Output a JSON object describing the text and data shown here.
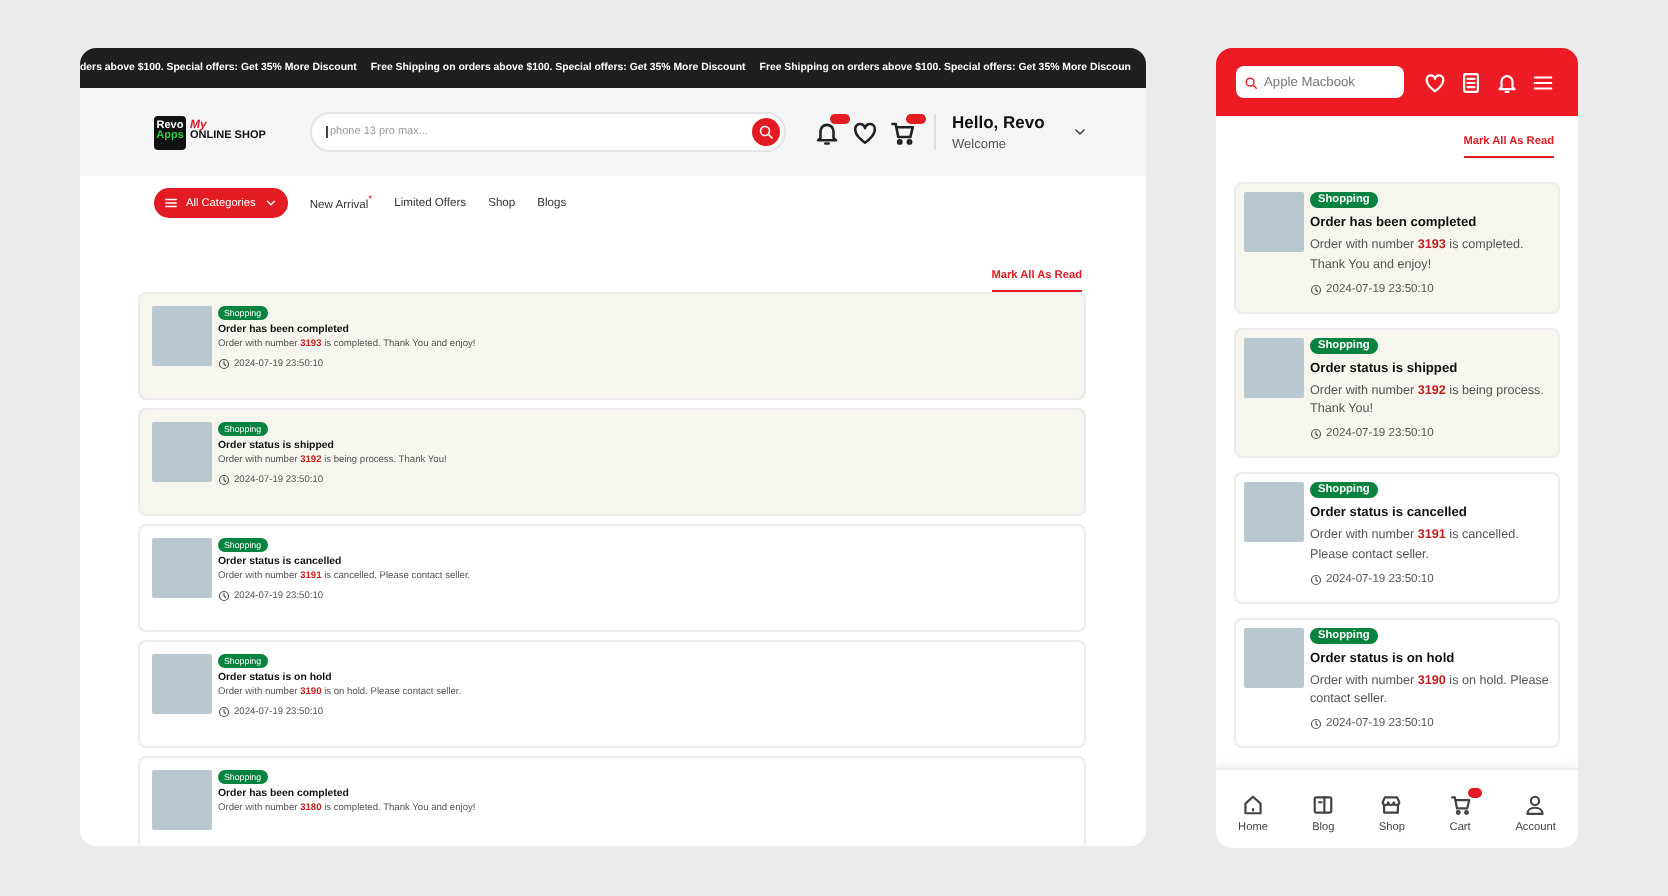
{
  "desktop": {
    "ticker": [
      "ders above $100. Special offers: Get 35% More Discount",
      "Free Shipping on orders above $100. Special offers: Get 35% More Discount",
      "Free Shipping on orders above $100. Special offers: Get 35% More Discoun"
    ],
    "logo": {
      "mark_top": "Revo",
      "mark_bottom": "Apps",
      "script": "My",
      "name": "ONLINE SHOP"
    },
    "search": {
      "placeholder": "phone 13 pro max..."
    },
    "greeting": {
      "title": "Hello, Revo",
      "subtitle": "Welcome"
    },
    "nav": [
      {
        "label": "All Categories",
        "kind": "menu"
      },
      {
        "label": "New Arrival$^{*}$",
        "kind": "link"
      },
      {
        "label": "Limited Offers",
        "kind": "link"
      },
      {
        "label": "Shop",
        "kind": "link"
      },
      {
        "label": "Blogs",
        "kind": "link"
      }
    ],
    "mark_all": "Mark All As Read",
    "notifications": [
      {
        "tag": "Shopping",
        "title": "Order has been completed",
        "message": "Order with number **3193** is completed. Thank You and enjoy!",
        "time": "2024-07-19 23:50:10",
        "unread": true
      },
      {
        "tag": "Shopping",
        "title": "Order status is shipped",
        "message": "Order with number **3192** is being process. Thank You!",
        "time": "2024-07-19 23:50:10",
        "unread": true
      },
      {
        "tag": "Shopping",
        "title": "Order status is cancelled",
        "message": "Order with number **3191** is cancelled. Please contact seller.",
        "time": "2024-07-19 23:50:10",
        "unread": false
      },
      {
        "tag": "Shopping",
        "title": "Order status is on hold",
        "message": "Order with number **3190** is on hold.  Please contact seller.",
        "time": "2024-07-19 23:50:10",
        "unread": false
      },
      {
        "tag": "Shopping",
        "title": "Order has been completed",
        "message": "Order with number **3180** is completed. Thank You and enjoy!",
        "unread": false
      }
    ]
  },
  "mobile": {
    "search": {
      "placeholder": "Apple Macbook"
    },
    "mark_all": "Mark All As Read",
    "notifications": [
      {
        "tag": "Shopping",
        "title": "Order has been completed",
        "message": "Order with number **3193** is completed. Thank You and enjoy!",
        "time": "2024-07-19  23:50:10",
        "unread": true
      },
      {
        "tag": "Shopping",
        "title": "Order status is shipped",
        "message": "Order with number **3192** is being process. Thank You!",
        "time": "2024-07-19  23:50:10",
        "unread": true
      },
      {
        "tag": "Shopping",
        "title": "Order status is cancelled",
        "message": "Order with number **3191** is cancelled. Please contact seller.",
        "time": "2024-07-19  23:50:10",
        "unread": false
      },
      {
        "tag": "Shopping",
        "title": "Order status is on hold",
        "message": "Order with number **3190** is on hold. Please contact seller.",
        "time": "2024-07-19  23:50:10",
        "unread": false
      }
    ],
    "tabs": [
      {
        "label": "Home",
        "kind": "home"
      },
      {
        "label": "Blog",
        "kind": "blog"
      },
      {
        "label": "Shop",
        "kind": "shop"
      },
      {
        "label": "Cart",
        "kind": "cart"
      },
      {
        "label": "Account",
        "kind": "account"
      }
    ]
  }
}
